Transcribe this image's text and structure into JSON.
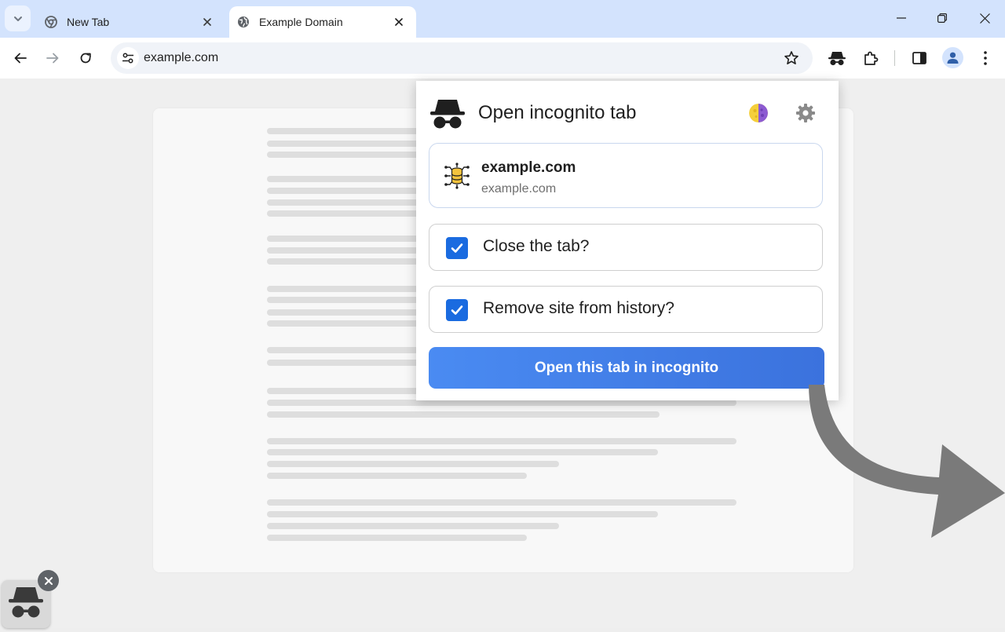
{
  "tabs": [
    {
      "title": "New Tab",
      "favicon": "chrome-icon",
      "active": false
    },
    {
      "title": "Example Domain",
      "favicon": "globe-icon",
      "active": true
    }
  ],
  "omnibox": {
    "url": "example.com"
  },
  "popup": {
    "title": "Open incognito tab",
    "site": {
      "name": "example.com",
      "url": "example.com"
    },
    "options": [
      {
        "label": "Close the tab?",
        "checked": true
      },
      {
        "label": "Remove site from history?",
        "checked": true
      }
    ],
    "cta_label": "Open this tab in incognito"
  },
  "colors": {
    "accent": "#1a6be0",
    "button_gradient_start": "#4a8bf2",
    "button_gradient_end": "#3b72dd",
    "titlebar": "#d3e3fd"
  }
}
